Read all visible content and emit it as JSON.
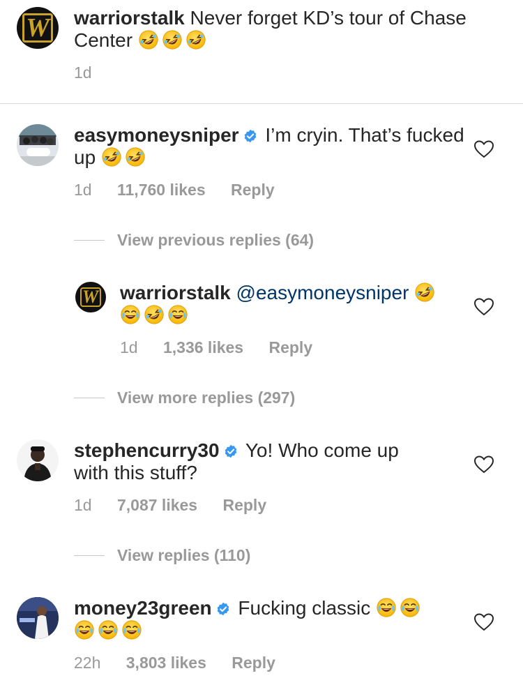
{
  "caption": {
    "username": "warriorstalk",
    "text": "Never forget KD’s tour of Chase Center",
    "time": "1d",
    "emojis": [
      "rofl-emoji",
      "rofl-emoji",
      "rofl-emoji"
    ]
  },
  "comments": [
    {
      "username": "easymoneysniper",
      "verified": true,
      "text": "I’m cryin. That’s fucked up",
      "time": "1d",
      "likes": "11,760 likes",
      "reply": "Reply",
      "view_replies": "View previous replies (64)"
    },
    {
      "username": "warriorstalk",
      "mention": "@easymoneysniper",
      "time": "1d",
      "likes": "1,336 likes",
      "reply": "Reply",
      "view_replies": "View more replies (297)"
    },
    {
      "username": "stephencurry30",
      "verified": true,
      "text_line1": "Yo! Who come up",
      "text_line2": "with this stuff?",
      "time": "1d",
      "likes": "7,087 likes",
      "reply": "Reply",
      "view_replies": "View replies (110)"
    },
    {
      "username": "money23green",
      "verified": true,
      "text": "Fucking classic",
      "time": "22h",
      "likes": "3,803 likes",
      "reply": "Reply"
    }
  ],
  "colors": {
    "text": "#262626",
    "meta": "#999999",
    "mention": "#003569",
    "verified": "#3897f0",
    "divider": "#dbdbdb",
    "warriors_gold": "#c9a227"
  }
}
